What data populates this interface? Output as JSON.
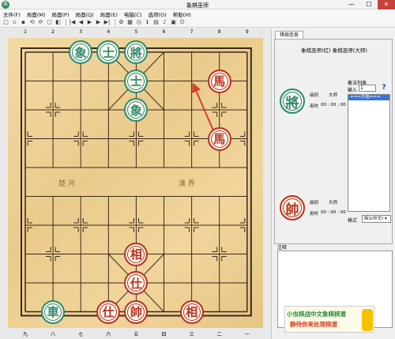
{
  "window": {
    "title": "象棋巫师",
    "minimize": "—",
    "maximize": "☐",
    "close": "✕",
    "app_icon": "巫"
  },
  "menu": [
    "文件(F)",
    "局面(M)",
    "局面(P)",
    "局面(Q)",
    "局面(E)",
    "电脑(C)",
    "选项(O)",
    "帮助(H)"
  ],
  "toolbar_icons": [
    "new-icon",
    "open-icon",
    "save-icon",
    "undo-icon",
    "redo-icon",
    "copy-icon",
    "paste-icon",
    "first-icon",
    "prev-icon",
    "play-icon",
    "next-icon",
    "last-icon",
    "settings-icon",
    "board-icon",
    "clock-icon",
    "info-icon",
    "chart-icon",
    "sound-icon",
    "save2-icon",
    "exit-icon"
  ],
  "toolbar_glyphs": [
    "□",
    "▫",
    "▪",
    "⟲",
    "⟳",
    "▢",
    "◧",
    "|◀",
    "◀",
    "▶",
    "▶",
    "▶|",
    "⚙",
    "▦",
    "◷",
    "ℹ",
    "▤",
    "♪",
    "▣",
    "⏻"
  ],
  "board": {
    "top_coords": [
      "1",
      "2",
      "3",
      "4",
      "5",
      "6",
      "7",
      "8",
      "9"
    ],
    "bottom_coords": [
      "九",
      "八",
      "七",
      "六",
      "五",
      "四",
      "三",
      "二",
      "一"
    ],
    "river_left": "楚 河",
    "river_right": "漢 界",
    "pieces": [
      {
        "char": "象",
        "side": "green",
        "file": 2,
        "rank": 0
      },
      {
        "char": "士",
        "side": "green",
        "file": 3,
        "rank": 0
      },
      {
        "char": "將",
        "side": "green",
        "file": 4,
        "rank": 0
      },
      {
        "char": "士",
        "side": "green",
        "file": 4,
        "rank": 1
      },
      {
        "char": "象",
        "side": "green",
        "file": 4,
        "rank": 2
      },
      {
        "char": "馬",
        "side": "red",
        "file": 7,
        "rank": 1
      },
      {
        "char": "馬",
        "side": "red",
        "file": 7,
        "rank": 3
      },
      {
        "char": "相",
        "side": "red",
        "file": 4,
        "rank": 7
      },
      {
        "char": "仕",
        "side": "red",
        "file": 4,
        "rank": 8
      },
      {
        "char": "車",
        "side": "green",
        "file": 1,
        "rank": 9
      },
      {
        "char": "仕",
        "side": "red",
        "file": 3,
        "rank": 9
      },
      {
        "char": "帥",
        "side": "red",
        "file": 4,
        "rank": 9
      },
      {
        "char": "相",
        "side": "red",
        "file": 6,
        "rank": 9
      }
    ]
  },
  "side": {
    "tab": "棋局信息",
    "match_title": "象棋巫师(红) 象棋巫师(大师)",
    "black_badge": "將",
    "red_badge": "帥",
    "black_level_label": "级别",
    "black_level": "大师",
    "black_time_label": "用时",
    "black_time": "00 : 00 : 00",
    "red_level_label": "级别",
    "red_level": "大师",
    "red_time_label": "用时",
    "red_time": "00 : 00 : 00",
    "moves_label": "着法列表",
    "input_label": "输入",
    "input_value": "1",
    "help": "?",
    "moves": [
      "===开始==="
    ],
    "format_label": "格式",
    "format_value": "纵1(中文) ▾",
    "notes_label": "注释",
    "banner_line1": "小虫棋战中文象棋棋谱",
    "banner_line2": "静待你来处理棋谱"
  },
  "colors": {
    "green_piece": "#2a8c74",
    "red_piece": "#b83222",
    "board": "#eacb8c",
    "arrow": "#d6402c"
  }
}
